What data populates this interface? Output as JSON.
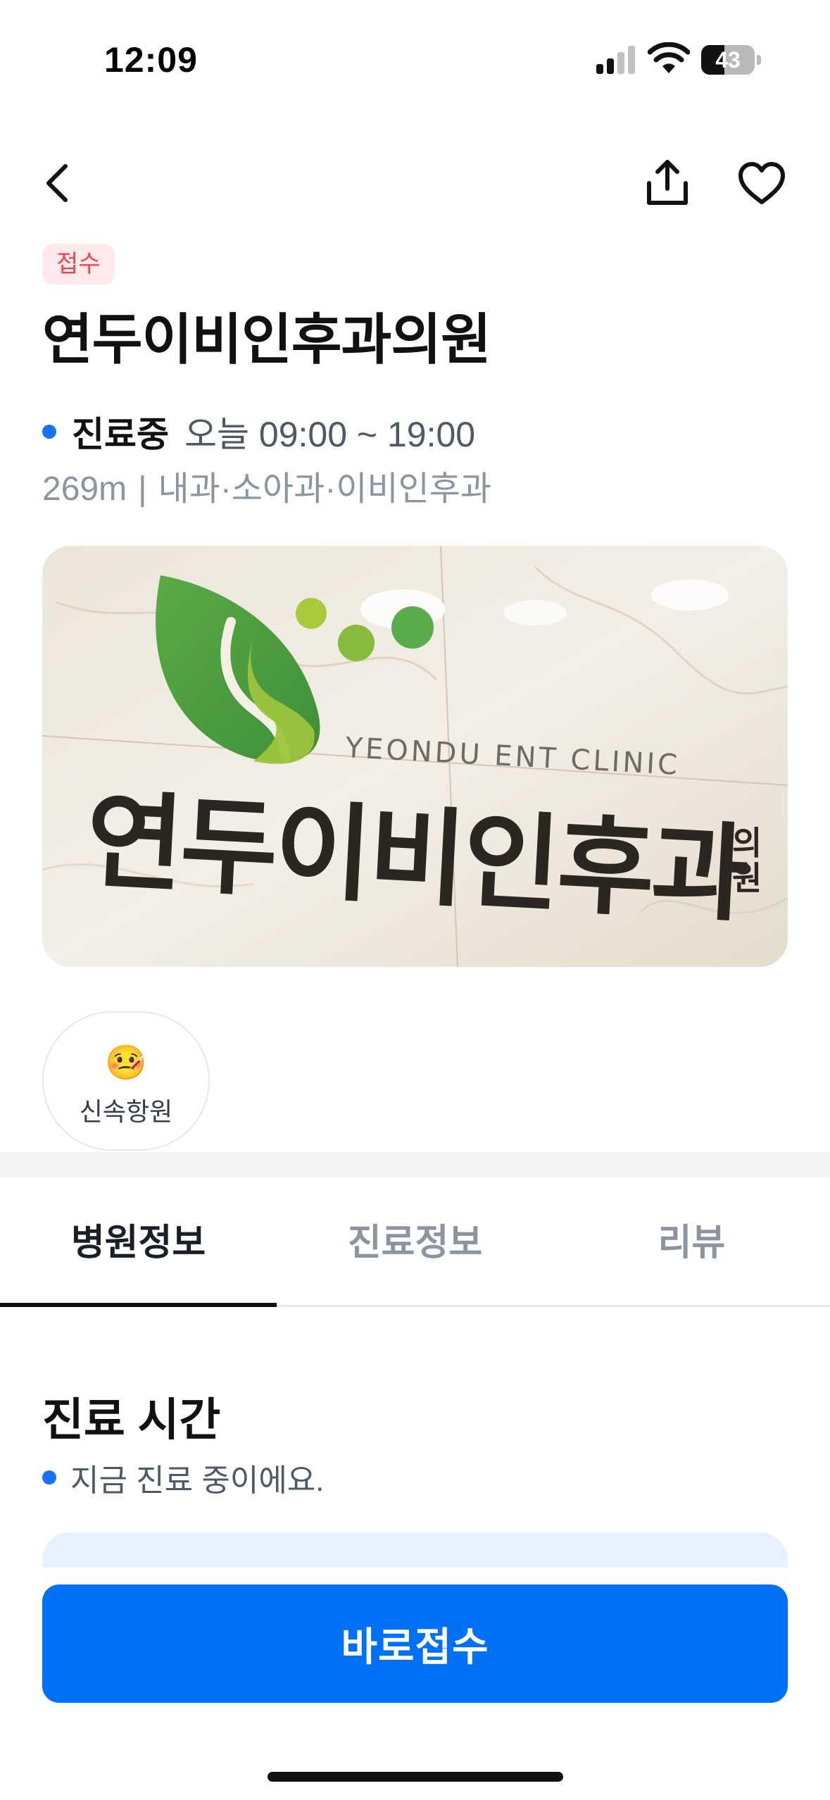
{
  "status_bar": {
    "time": "12:09",
    "battery_level": "43",
    "battery_fraction": 0.43
  },
  "nav": {
    "back_icon": "chevron-left-icon",
    "share_icon": "share-icon",
    "like_icon": "heart-icon"
  },
  "clinic": {
    "badge": "접수",
    "name": "연두이비인후과의원",
    "status_label": "진료중",
    "status_hours": "오늘 09:00 ~ 19:00",
    "distance": "269m",
    "separator": "|",
    "departments": "내과·소아과·이비인후과"
  },
  "photo": {
    "sign_english": "YEONDU ENT CLINIC",
    "sign_korean": "연두이비인후과",
    "sign_small_1": "의",
    "sign_small_2": "원"
  },
  "tags": [
    {
      "icon": "🤒",
      "label": "신속항원"
    }
  ],
  "tabs": [
    {
      "label": "병원정보",
      "active": true
    },
    {
      "label": "진료정보",
      "active": false
    },
    {
      "label": "리뷰",
      "active": false
    }
  ],
  "hours_section": {
    "title": "진료 시간",
    "subtitle": "지금 진료 중이에요."
  },
  "cta": {
    "label": "바로접수"
  },
  "colors": {
    "accent": "#0071f7",
    "dot": "#1971ff",
    "badge_text": "#f04452",
    "badge_bg": "#ffe9ea"
  }
}
